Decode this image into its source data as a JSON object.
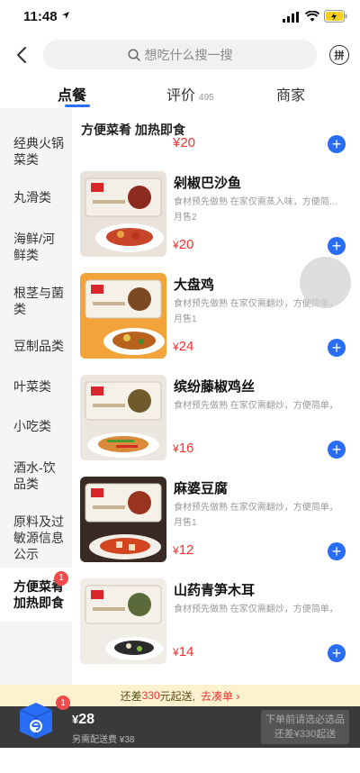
{
  "status": {
    "time": "11:48"
  },
  "header": {
    "search_placeholder": "想吃什么搜一搜",
    "share_label": "拼"
  },
  "tabs": [
    {
      "label": "点餐"
    },
    {
      "label": "评价",
      "count": "495"
    },
    {
      "label": "商家"
    }
  ],
  "sidebar": {
    "categories": [
      {
        "label": "经典火锅菜类"
      },
      {
        "label": "丸滑类"
      },
      {
        "label": "海鲜/河鲜类"
      },
      {
        "label": "根茎与菌类"
      },
      {
        "label": "豆制品类"
      },
      {
        "label": "叶菜类"
      },
      {
        "label": "小吃类"
      },
      {
        "label": "酒水-饮品类"
      },
      {
        "label": "原料及过敏源信息公示"
      },
      {
        "label": "方便菜肴加热即食",
        "badge": "1"
      }
    ]
  },
  "content": {
    "section_title": "方便菜肴 加热即食",
    "partial_price": "¥20",
    "items": [
      {
        "name": "剁椒巴沙鱼",
        "desc": "食材预先做熟 在家仅需蒸入味，方便简单，",
        "sales": "月售2",
        "currency": "¥",
        "price": "20"
      },
      {
        "name": "大盘鸡",
        "desc": "食材预先做熟 在家仅需翻炒，方便简单，",
        "sales": "月售1",
        "currency": "¥",
        "price": "24"
      },
      {
        "name": "缤纷藤椒鸡丝",
        "desc": "食材预先做熟 在家仅需翻炒，方便简单，",
        "sales": "",
        "currency": "¥",
        "price": "16"
      },
      {
        "name": "麻婆豆腐",
        "desc": "食材预先做熟 在家仅需翻炒，方便简单，",
        "sales": "月售1",
        "currency": "¥",
        "price": "12"
      },
      {
        "name": "山药青笋木耳",
        "desc": "食材预先做熟 在家仅需翻炒，方便简单，",
        "sales": "",
        "currency": "¥",
        "price": "14"
      }
    ]
  },
  "notice": {
    "prefix": "还差",
    "amount": "330",
    "suffix": "元起送,",
    "link": "去凑单 ›"
  },
  "cart": {
    "badge": "1",
    "currency": "¥",
    "total": "28",
    "fee": "另需配送费 ¥38",
    "checkout_line1": "下单前请选必选品",
    "checkout_line2": "还差¥330起送"
  },
  "colors": {
    "accent": "#2a6df5",
    "price": "#f03333",
    "badge": "#f34b4b"
  }
}
